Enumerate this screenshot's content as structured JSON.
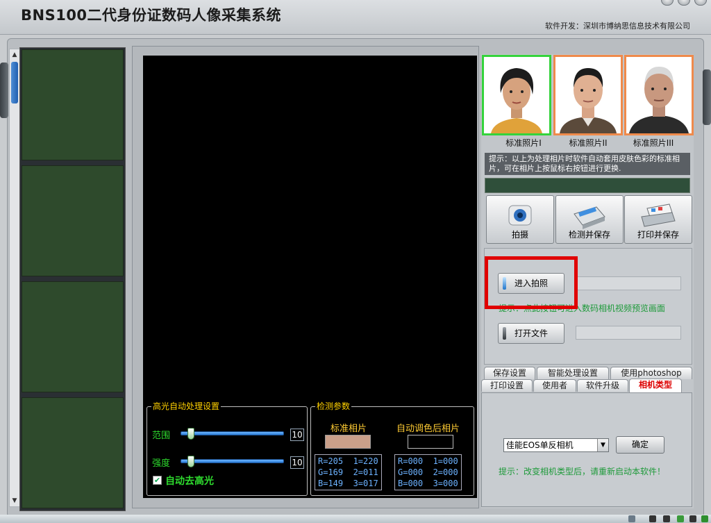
{
  "app": {
    "title": "BNS100二代身份证数码人像采集系统",
    "developer": "软件开发：深圳市博纳思信息技术有限公司"
  },
  "highlight_settings": {
    "title": "高光自动处理设置",
    "range_label": "范围",
    "range_value": "10",
    "range_level": 0.1,
    "strength_label": "强度",
    "strength_value": "10",
    "strength_level": 0.1,
    "auto_remove_label": "自动去高光",
    "auto_remove_checked": true
  },
  "detect_params": {
    "title": "检测参数",
    "standard_label": "标准相片",
    "adjusted_label": "自动调色后相片",
    "standard_swatch_color": "#caa08a",
    "standard_values": [
      "R=205  1=220",
      "G=169  2=011",
      "B=149  3=017"
    ],
    "adjusted_values": [
      "R=000  1=000",
      "G=000  2=000",
      "B=000  3=000"
    ]
  },
  "standard_photos": [
    {
      "caption": "标准照片I",
      "selected": true
    },
    {
      "caption": "标准照片II",
      "selected": false
    },
    {
      "caption": "标准照片III",
      "selected": false
    }
  ],
  "tip": "提示：以上为处理相片时软件自动套用皮肤色彩的标准相片，可在相片上按鼠标右按钮进行更换.",
  "action_buttons": {
    "shoot": "拍摄",
    "detect_save": "检测并保存",
    "print_save": "打印并保存"
  },
  "camera": {
    "enter_shoot": "进入拍照",
    "enter_hint": "提示：点此按钮可进入数码相机视频预览画面",
    "open_file": "打开文件"
  },
  "tabs_row1": [
    "保存设置",
    "智能处理设置",
    "使用photoshop"
  ],
  "tabs_row2": [
    "打印设置",
    "使用者",
    "软件升级",
    "相机类型"
  ],
  "active_tab": "相机类型",
  "camera_type": {
    "selected": "佳能EOS单反相机",
    "confirm": "确定",
    "restart_hint": "提示：改变相机类型后，请重新启动本软件！"
  },
  "colors": {
    "selected_border": "#34d33b",
    "photo_border": "#ef8a4b",
    "highlight_red": "#e00000",
    "hint_green": "#1e9a3a"
  }
}
